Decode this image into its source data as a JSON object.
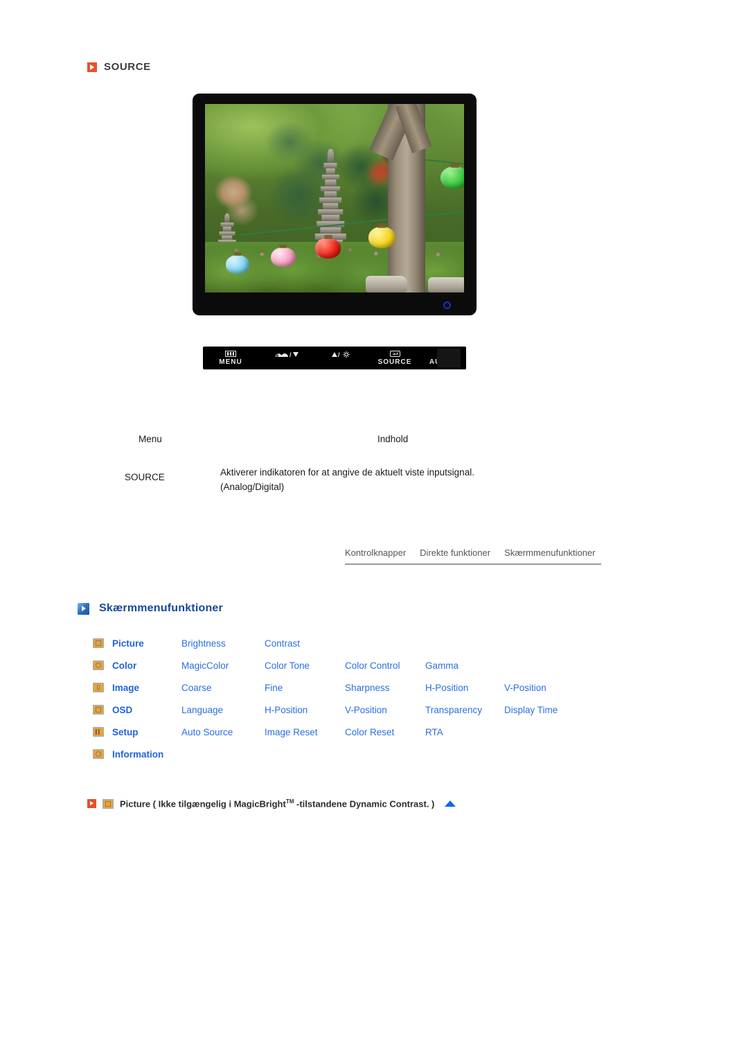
{
  "source_section": {
    "icon": "arrow-right-orange-icon",
    "label": "SOURCE"
  },
  "monitor": {
    "power_led": "power-led-blue",
    "screen_photo_description": "Garden with stone pagoda, trees and colored paper lanterns"
  },
  "control_bar": {
    "buttons": [
      {
        "label": "MENU",
        "glyph": "menu-bars-icon"
      },
      {
        "label": "/",
        "glyph": "contrast-down-icon"
      },
      {
        "label": "/",
        "glyph": "up-brightness-icon"
      },
      {
        "label": "SOURCE",
        "glyph": "enter-return-icon"
      },
      {
        "label": "AUTO",
        "glyph": ""
      }
    ],
    "power_button": "power-button"
  },
  "info_table": {
    "headers": {
      "menu": "Menu",
      "content": "Indhold"
    },
    "rows": [
      {
        "menu": "SOURCE",
        "content_line1": "Aktiverer indikatoren for at angive de aktuelt viste inputsignal.",
        "content_line2": "(Analog/Digital)"
      }
    ]
  },
  "tabs": [
    {
      "label": "Kontrolknapper"
    },
    {
      "label": "Direkte funktioner"
    },
    {
      "label": "Skærmmenufunktioner"
    }
  ],
  "section": {
    "icon": "arrow-right-blue-icon",
    "title": "Skærmmenufunktioner"
  },
  "osd_menu": {
    "rows": [
      {
        "icon": "picture-icon",
        "category": "Picture",
        "items": [
          "Brightness",
          "Contrast",
          "",
          "",
          ""
        ]
      },
      {
        "icon": "color-icon",
        "category": "Color",
        "items": [
          "MagicColor",
          "Color Tone",
          "Color Control",
          "Gamma",
          ""
        ]
      },
      {
        "icon": "image-icon",
        "category": "Image",
        "items": [
          "Coarse",
          "Fine",
          "Sharpness",
          "H-Position",
          "V-Position"
        ]
      },
      {
        "icon": "osd-icon",
        "category": "OSD",
        "items": [
          "Language",
          "H-Position",
          "V-Position",
          "Transparency",
          "Display Time"
        ]
      },
      {
        "icon": "setup-icon",
        "category": "Setup",
        "items": [
          "Auto Source",
          "Image Reset",
          "Color Reset",
          "RTA",
          ""
        ]
      },
      {
        "icon": "information-icon",
        "category": "Information",
        "items": [
          "",
          "",
          "",
          "",
          ""
        ]
      }
    ]
  },
  "caption": {
    "arrow_icon": "arrow-right-orange-icon",
    "picture_icon": "picture-icon",
    "text_before_tm": "Picture ( Ikke tilgængelig i MagicBright",
    "tm": "TM",
    "text_after_tm": " -tilstandene Dynamic Contrast. )",
    "top_arrow_icon": "scroll-to-top-arrow-icon"
  },
  "colors": {
    "orange_accent": "#e8502a",
    "blue_heading": "#17479e",
    "blue_link": "#2a6fdf",
    "icon_orange": "#f0a22e",
    "led_blue": "#1a2ed0"
  }
}
